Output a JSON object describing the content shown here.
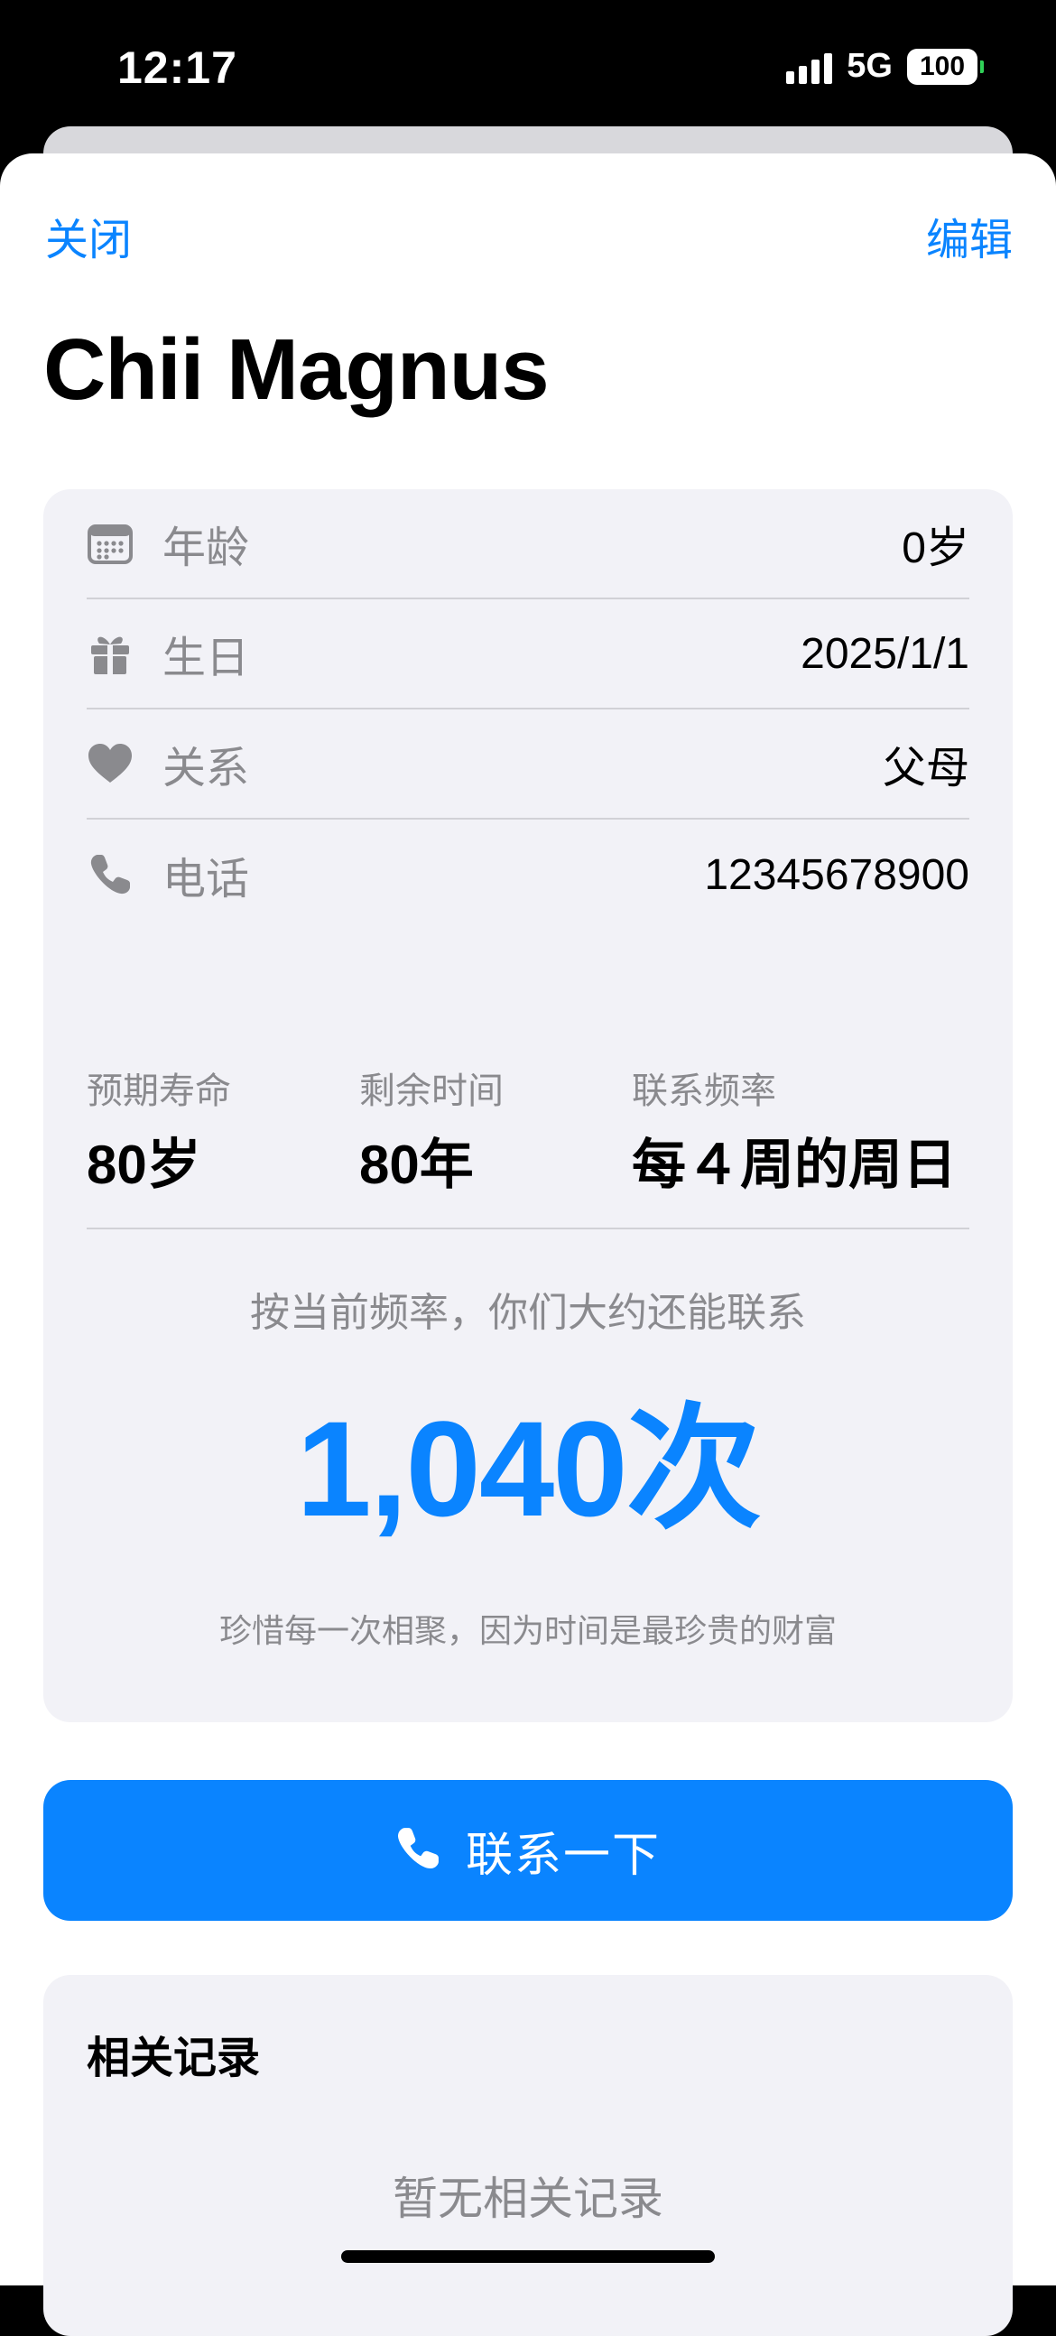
{
  "status_bar": {
    "time": "12:17",
    "network": "5G",
    "battery": "100"
  },
  "nav": {
    "close_label": "关闭",
    "edit_label": "编辑"
  },
  "contact_name": "Chii Magnus",
  "info": {
    "items": [
      {
        "icon": "calendar-icon",
        "label": "年龄",
        "value": "0岁"
      },
      {
        "icon": "gift-icon",
        "label": "生日",
        "value": "2025/1/1"
      },
      {
        "icon": "heart-icon",
        "label": "关系",
        "value": "父母"
      },
      {
        "icon": "phone-icon",
        "label": "电话",
        "value": "12345678900"
      }
    ]
  },
  "stats": {
    "expected_life_label": "预期寿命",
    "expected_life_value": "80岁",
    "remaining_label": "剩余时间",
    "remaining_value": "80年",
    "frequency_label": "联系频率",
    "frequency_value": "每４周的周日",
    "caption": "按当前频率，你们大约还能联系",
    "count": "1,040次",
    "quote": "珍惜每一次相聚，因为时间是最珍贵的财富"
  },
  "contact_button": {
    "label": "联系一下",
    "icon": "phone-icon"
  },
  "records": {
    "title": "相关记录",
    "empty_text": "暂无相关记录"
  },
  "colors": {
    "accent": "#0a84ff",
    "card_bg": "#f2f2f7",
    "secondary_text": "#8a8a8e"
  }
}
